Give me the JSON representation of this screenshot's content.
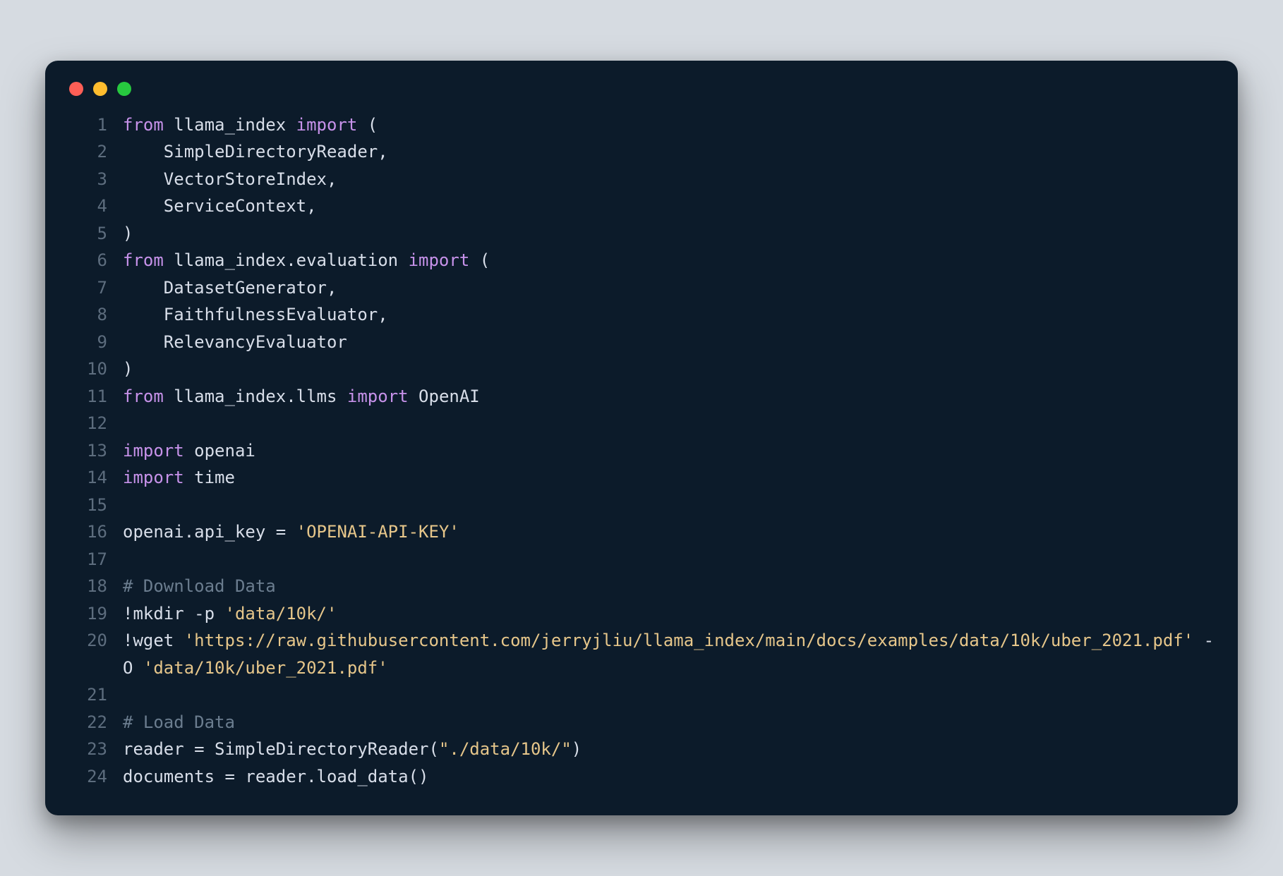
{
  "window": {
    "traffic": [
      "close",
      "minimize",
      "zoom"
    ]
  },
  "code": {
    "lines": [
      {
        "n": "1",
        "tokens": [
          {
            "c": "kw",
            "t": "from"
          },
          {
            "c": "plain",
            "t": " llama_index "
          },
          {
            "c": "kw",
            "t": "import"
          },
          {
            "c": "plain",
            "t": " ("
          }
        ]
      },
      {
        "n": "2",
        "tokens": [
          {
            "c": "plain",
            "t": "    SimpleDirectoryReader,"
          }
        ]
      },
      {
        "n": "3",
        "tokens": [
          {
            "c": "plain",
            "t": "    VectorStoreIndex,"
          }
        ]
      },
      {
        "n": "4",
        "tokens": [
          {
            "c": "plain",
            "t": "    ServiceContext,"
          }
        ]
      },
      {
        "n": "5",
        "tokens": [
          {
            "c": "plain",
            "t": ")"
          }
        ]
      },
      {
        "n": "6",
        "tokens": [
          {
            "c": "kw",
            "t": "from"
          },
          {
            "c": "plain",
            "t": " llama_index.evaluation "
          },
          {
            "c": "kw",
            "t": "import"
          },
          {
            "c": "plain",
            "t": " ("
          }
        ]
      },
      {
        "n": "7",
        "tokens": [
          {
            "c": "plain",
            "t": "    DatasetGenerator,"
          }
        ]
      },
      {
        "n": "8",
        "tokens": [
          {
            "c": "plain",
            "t": "    FaithfulnessEvaluator,"
          }
        ]
      },
      {
        "n": "9",
        "tokens": [
          {
            "c": "plain",
            "t": "    RelevancyEvaluator"
          }
        ]
      },
      {
        "n": "10",
        "tokens": [
          {
            "c": "plain",
            "t": ")"
          }
        ]
      },
      {
        "n": "11",
        "tokens": [
          {
            "c": "kw",
            "t": "from"
          },
          {
            "c": "plain",
            "t": " llama_index.llms "
          },
          {
            "c": "kw",
            "t": "import"
          },
          {
            "c": "plain",
            "t": " OpenAI"
          }
        ]
      },
      {
        "n": "12",
        "tokens": [
          {
            "c": "plain",
            "t": ""
          }
        ]
      },
      {
        "n": "13",
        "tokens": [
          {
            "c": "kw",
            "t": "import"
          },
          {
            "c": "plain",
            "t": " openai"
          }
        ]
      },
      {
        "n": "14",
        "tokens": [
          {
            "c": "kw",
            "t": "import"
          },
          {
            "c": "plain",
            "t": " time"
          }
        ]
      },
      {
        "n": "15",
        "tokens": [
          {
            "c": "plain",
            "t": ""
          }
        ]
      },
      {
        "n": "16",
        "tokens": [
          {
            "c": "plain",
            "t": "openai.api_key = "
          },
          {
            "c": "str",
            "t": "'OPENAI-API-KEY'"
          }
        ]
      },
      {
        "n": "17",
        "tokens": [
          {
            "c": "plain",
            "t": ""
          }
        ]
      },
      {
        "n": "18",
        "tokens": [
          {
            "c": "comment",
            "t": "# Download Data"
          }
        ]
      },
      {
        "n": "19",
        "tokens": [
          {
            "c": "plain",
            "t": "!mkdir -p "
          },
          {
            "c": "str",
            "t": "'data/10k/'"
          }
        ]
      },
      {
        "n": "20",
        "tokens": [
          {
            "c": "plain",
            "t": "!wget "
          },
          {
            "c": "str",
            "t": "'https://raw.githubusercontent.com/jerryjliu/llama_index/main/docs/examples/data/10k/uber_2021.pdf'"
          },
          {
            "c": "plain",
            "t": " -O "
          },
          {
            "c": "str",
            "t": "'data/10k/uber_2021.pdf'"
          }
        ]
      },
      {
        "n": "21",
        "tokens": [
          {
            "c": "plain",
            "t": ""
          }
        ]
      },
      {
        "n": "22",
        "tokens": [
          {
            "c": "comment",
            "t": "# Load Data"
          }
        ]
      },
      {
        "n": "23",
        "tokens": [
          {
            "c": "plain",
            "t": "reader = SimpleDirectoryReader("
          },
          {
            "c": "str",
            "t": "\"./data/10k/\""
          },
          {
            "c": "plain",
            "t": ")"
          }
        ]
      },
      {
        "n": "24",
        "tokens": [
          {
            "c": "plain",
            "t": "documents = reader.load_data()"
          }
        ]
      }
    ]
  }
}
